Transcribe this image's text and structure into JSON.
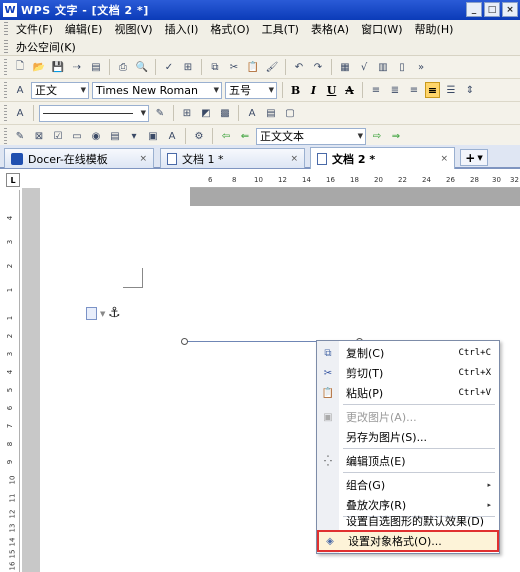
{
  "window": {
    "app_icon": "W",
    "title": "WPS 文字 - [文档 2 *]",
    "btn_min": "_",
    "btn_max": "□",
    "btn_close": "×"
  },
  "menu": {
    "row1": [
      "文件(F)",
      "编辑(E)",
      "视图(V)",
      "插入(I)",
      "格式(O)",
      "工具(T)",
      "表格(A)",
      "窗口(W)",
      "帮助(H)"
    ],
    "row2": [
      "办公空间(K)"
    ]
  },
  "format_toolbar": {
    "style_value": "正文",
    "font_value": "Times New Roman",
    "size_value": "五号",
    "bold": "B",
    "italic": "I",
    "underline": "U",
    "strike": "A"
  },
  "draw_toolbar": {
    "text_style_value": "正文文本"
  },
  "tabs": [
    {
      "label": "Docer-在线模板"
    },
    {
      "label": "文档 1 *"
    },
    {
      "label": "文档 2 *"
    }
  ],
  "tab_close": "×",
  "add_tab": "+",
  "ruler": {
    "corner": "L",
    "h_labels": [
      "6",
      "8",
      "10",
      "12",
      "14",
      "16",
      "18",
      "20",
      "22",
      "24",
      "26",
      "28",
      "30",
      "32"
    ],
    "v_labels": [
      "4",
      "3",
      "2",
      "1",
      "1",
      "2",
      "3",
      "4",
      "5",
      "6",
      "7",
      "8",
      "9",
      "10",
      "11",
      "12",
      "13",
      "14",
      "15",
      "16"
    ]
  },
  "context_menu": {
    "items": [
      {
        "label": "复制(C)",
        "shortcut": "Ctrl+C",
        "icon": "copy-icon",
        "glyph": "⧉"
      },
      {
        "label": "剪切(T)",
        "shortcut": "Ctrl+X",
        "icon": "cut-icon",
        "glyph": "✂"
      },
      {
        "label": "粘贴(P)",
        "shortcut": "Ctrl+V",
        "icon": "paste-icon",
        "glyph": "📋"
      },
      {
        "label": "更改图片(A)...",
        "icon": "change-picture-icon",
        "glyph": "▣",
        "disabled": true
      },
      {
        "label": "另存为图片(S)...",
        "icon": "",
        "glyph": ""
      },
      {
        "label": "编辑顶点(E)",
        "icon": "edit-points-icon",
        "glyph": "⁛"
      },
      {
        "label": "组合(G)",
        "icon": "",
        "glyph": "",
        "submenu": true
      },
      {
        "label": "叠放次序(R)",
        "icon": "",
        "glyph": "",
        "submenu": true
      },
      {
        "label": "设置自选图形的默认效果(D)",
        "icon": "",
        "glyph": ""
      },
      {
        "label": "设置对象格式(O)...",
        "icon": "format-object-icon",
        "glyph": "◈",
        "highlighted": true
      }
    ],
    "submenu_arrow": "▸"
  },
  "colors": {
    "titlebar": "#0b3bb8",
    "highlight_border": "#e03030"
  }
}
